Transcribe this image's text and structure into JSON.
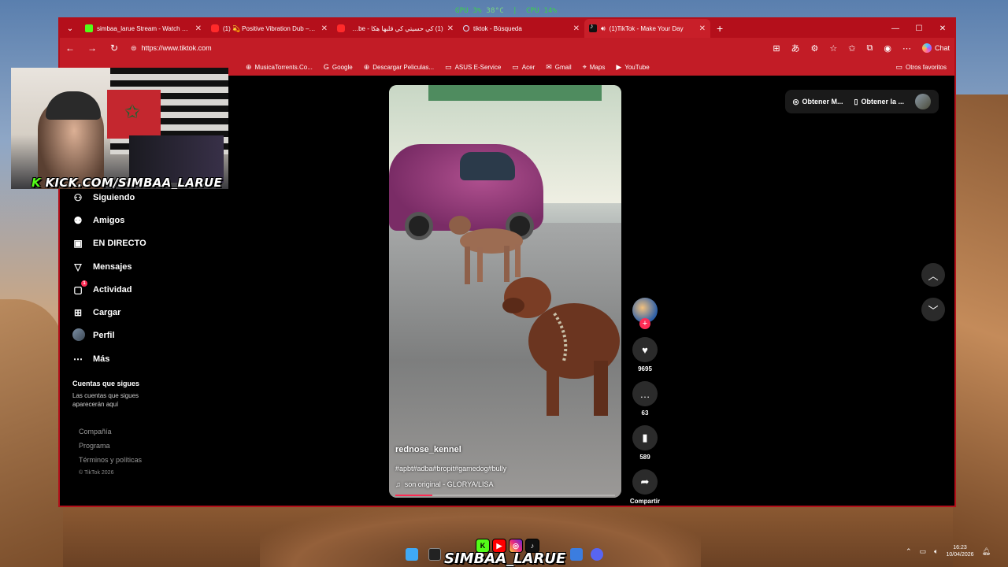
{
  "hud": {
    "gpu_label": "GPU",
    "gpu_load": "3%",
    "gpu_temp": "38°C",
    "cpu_label": "CPU",
    "cpu_load": "14%"
  },
  "tabs": [
    {
      "title": "simbaa_larue Stream - Watch Live",
      "icon": "kick-icon"
    },
    {
      "title": "(1) 💫 Positive Vibration Dub – Re",
      "icon": "youtube-icon"
    },
    {
      "title": "(1) كي حسيتي كي قلبها هكا - YouTube",
      "icon": "youtube-icon"
    },
    {
      "title": "tiktok - Búsqueda",
      "icon": "search-icon"
    },
    {
      "title": "(1)TikTok - Make Your Day",
      "icon": "tiktok-icon",
      "active": true
    }
  ],
  "address": {
    "url": "https://www.tiktok.com"
  },
  "chat_label": "Chat",
  "bookmarks": [
    "MusicaTorrents.Co...",
    "Google",
    "Descargar Peliculas...",
    "ASUS E-Service",
    "Acer",
    "Gmail",
    "Maps",
    "YouTube"
  ],
  "bookmarks_other": "Otros favoritos",
  "sidebar": {
    "items": [
      {
        "label": "Siguiendo",
        "icon": "following-icon"
      },
      {
        "label": "Amigos",
        "icon": "friends-icon"
      },
      {
        "label": "EN DIRECTO",
        "icon": "live-icon"
      },
      {
        "label": "Mensajes",
        "icon": "messages-icon"
      },
      {
        "label": "Actividad",
        "icon": "activity-icon",
        "badge": "1"
      },
      {
        "label": "Cargar",
        "icon": "upload-icon"
      },
      {
        "label": "Perfil",
        "icon": "profile-avatar"
      },
      {
        "label": "Más",
        "icon": "more-icon"
      }
    ],
    "follow_title": "Cuentas que sigues",
    "follow_desc": "Las cuentas que sigues aparecerán aquí",
    "footer": [
      "Compañía",
      "Programa",
      "Términos y políticas"
    ],
    "copyright": "© TikTok 2026"
  },
  "video": {
    "username": "rednose_kennel",
    "hashtags": "#apbt#adba#bropit#gamedog#bully",
    "sound": "son original - GLORYA/LISA",
    "progress": 0.17
  },
  "actions": {
    "likes": "9695",
    "comments": "63",
    "saves": "589",
    "share_label": "Compartir",
    "follow_plus": "+"
  },
  "top_right": {
    "get_app": "Obtener M...",
    "get_desktop": "Obtener la ..."
  },
  "webcam": {
    "label_k": "K",
    "label": "KICK.COM/SIMBAA_LARUE"
  },
  "stream_brand": {
    "name": "SIMBAA_LARUE"
  },
  "tray": {
    "time": "16:23",
    "date": "10/04/2026"
  },
  "colors": {
    "browser_red": "#c21c26",
    "tiktok_pink": "#fe2c55",
    "kick_green": "#53fc18"
  }
}
